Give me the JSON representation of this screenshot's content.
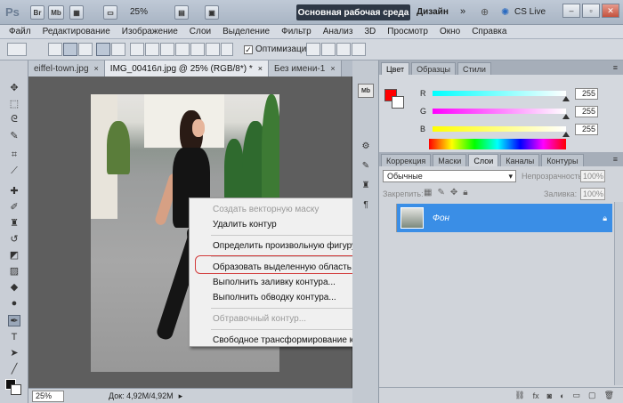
{
  "appbar": {
    "logo": "Ps",
    "btn_br": "Br",
    "btn_mb": "Mb",
    "zoom": "25%",
    "workspace_active": "Основная рабочая среда",
    "workspace_design": "Дизайн",
    "overflow": "»",
    "cs_live": "CS Live",
    "window_buttons": [
      "–",
      "▫",
      "✕"
    ]
  },
  "menubar": [
    "Файл",
    "Редактирование",
    "Изображение",
    "Слои",
    "Выделение",
    "Фильтр",
    "Анализ",
    "3D",
    "Просмотр",
    "Окно",
    "Справка"
  ],
  "options": {
    "auto_add_delete_label": "Оптимизация"
  },
  "doc_tabs": [
    {
      "label": "eiffel-town.jpg",
      "close": "×"
    },
    {
      "label": "IMG_00416л.jpg @ 25% (RGB/8*) *",
      "close": "×"
    },
    {
      "label": "Без имени-1",
      "close": "×"
    }
  ],
  "status": {
    "zoom": "25%",
    "doc": "Док: 4,92М/4,92М"
  },
  "context_menu": {
    "items": [
      {
        "label": "Создать векторную маску",
        "disabled": true
      },
      {
        "label": "Удалить контур",
        "disabled": false
      },
      {
        "sep": true
      },
      {
        "label": "Определить произвольную фигуру...",
        "disabled": false
      },
      {
        "sep": true
      },
      {
        "label": "Образовать выделенную область...",
        "disabled": false,
        "highlight": true
      },
      {
        "label": "Выполнить заливку контура...",
        "disabled": false
      },
      {
        "label": "Выполнить обводку контура...",
        "disabled": false
      },
      {
        "sep": true
      },
      {
        "label": "Обтравочный контур...",
        "disabled": true
      },
      {
        "sep": true
      },
      {
        "label": "Свободное трансформирование контура",
        "disabled": false
      }
    ]
  },
  "color_panel": {
    "tabs": [
      "Цвет",
      "Образцы",
      "Стили"
    ],
    "channels": [
      {
        "label": "R",
        "value": "255",
        "color_from": "#00ffff",
        "color_to": "#ffffff"
      },
      {
        "label": "G",
        "value": "255",
        "color_from": "#ff00ff",
        "color_to": "#ffffff"
      },
      {
        "label": "B",
        "value": "255",
        "color_from": "#ffff00",
        "color_to": "#ffffff"
      }
    ],
    "foreground": "#ff0000",
    "background": "#ffffff"
  },
  "layers_panel": {
    "tabs": [
      "Коррекция",
      "Маски",
      "Слои",
      "Каналы",
      "Контуры"
    ],
    "active_tab": "Слои",
    "blend_mode": "Обычные",
    "opacity_label": "Непрозрачность:",
    "opacity_value": "100%",
    "lock_label": "Закрепить:",
    "fill_label": "Заливка:",
    "fill_value": "100%",
    "layer_name": "Фон"
  }
}
